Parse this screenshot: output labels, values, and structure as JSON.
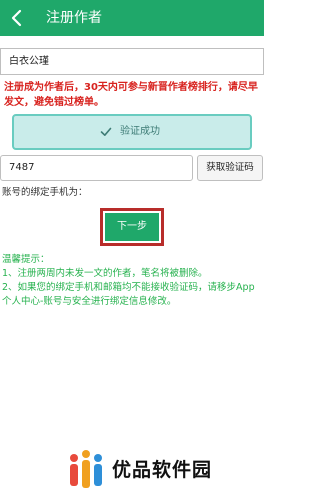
{
  "header": {
    "title": "注册作者",
    "background_color": "#1fa86a",
    "back_icon": "chevron-left-icon"
  },
  "form": {
    "name_value": "白衣公瑾",
    "notice": "注册成为作者后，30天内可参与新晋作者榜排行，请尽早发文，避免错过榜单。",
    "verify_status": "验证成功",
    "verify_icon": "check-icon",
    "code_value": "7487",
    "get_code_button": "获取验证码",
    "phone_label": "账号的绑定手机为：",
    "next_button": "下一步"
  },
  "tips": {
    "title": "温馨提示：",
    "items": [
      "1、注册两周内未发一文的作者，笔名将被删除。",
      "2、如果您的绑定手机和邮箱均不能接收验证码，请移步App个人中心-账号与安全进行绑定信息修改。"
    ]
  },
  "watermark": {
    "text": "优品软件园"
  }
}
